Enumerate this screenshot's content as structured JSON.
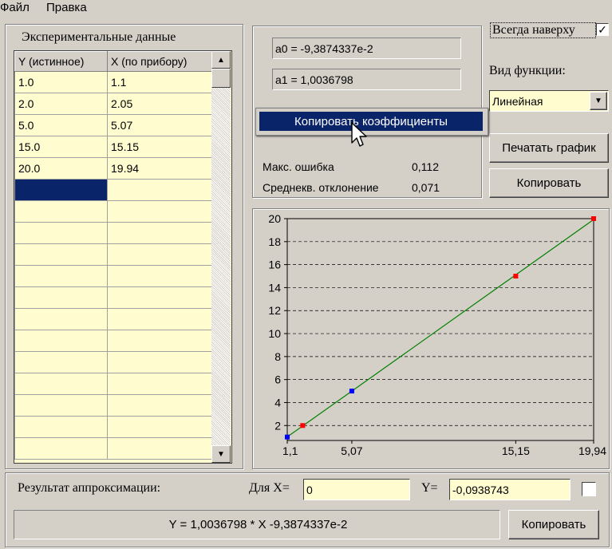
{
  "menu": {
    "file": "Файл",
    "edit": "Правка"
  },
  "always_on_top": {
    "label": "Всегда наверху",
    "checked": true,
    "mark": "✓"
  },
  "data_panel": {
    "title": "Экспериментальные данные",
    "columns": [
      "Y (истинное)",
      "X (по прибору)"
    ],
    "rows": [
      [
        "1.0",
        "1.1"
      ],
      [
        "2.0",
        "2.05"
      ],
      [
        "5.0",
        "5.07"
      ],
      [
        "15.0",
        "15.15"
      ],
      [
        "20.0",
        "19.94"
      ]
    ]
  },
  "coefficients": {
    "a0": "a0 = -9,3874337e-2",
    "a1": "a1 = 1,0036798",
    "max_error_label": "Макс. ошибка",
    "max_error_value": "0,112",
    "rms_label": "Среднекв. отклонение",
    "rms_value": "0,071"
  },
  "context_menu": {
    "copy_coeffs": "Копировать коэффициенты"
  },
  "function_type": {
    "label": "Вид функции:",
    "selected": "Линейная"
  },
  "buttons": {
    "print_chart": "Печатать график",
    "copy": "Копировать",
    "copy_bottom": "Копировать"
  },
  "result": {
    "label": "Результат аппроксимации:",
    "for_x_label": "Для X=",
    "x_value": "0",
    "y_label": "Y=",
    "y_value": "-0,0938743",
    "formula": "Y = 1,0036798 * X -9,3874337e-2"
  },
  "colors": {
    "fit_line": "#008000",
    "point_blue": "#0000ff",
    "point_red": "#ff0000",
    "selection": "#0a246a",
    "grid_bg": "#fffdd0"
  },
  "chart_data": {
    "type": "scatter",
    "x_ticks": [
      "1,1",
      "5,07",
      "15,15",
      "19,94"
    ],
    "y_ticks": [
      "2",
      "4",
      "6",
      "8",
      "10",
      "12",
      "14",
      "16",
      "18",
      "20"
    ],
    "xlim": [
      1.1,
      19.94
    ],
    "ylim": [
      0.7,
      20
    ],
    "points": [
      {
        "x": 1.1,
        "y": 1.0,
        "color": "blue"
      },
      {
        "x": 2.05,
        "y": 2.0,
        "color": "red"
      },
      {
        "x": 5.07,
        "y": 5.0,
        "color": "blue"
      },
      {
        "x": 15.15,
        "y": 15.0,
        "color": "red"
      },
      {
        "x": 19.94,
        "y": 20.0,
        "color": "red"
      }
    ],
    "fit": {
      "a0": -0.093874337,
      "a1": 1.0036798
    },
    "grid": "horizontal-dashed"
  }
}
